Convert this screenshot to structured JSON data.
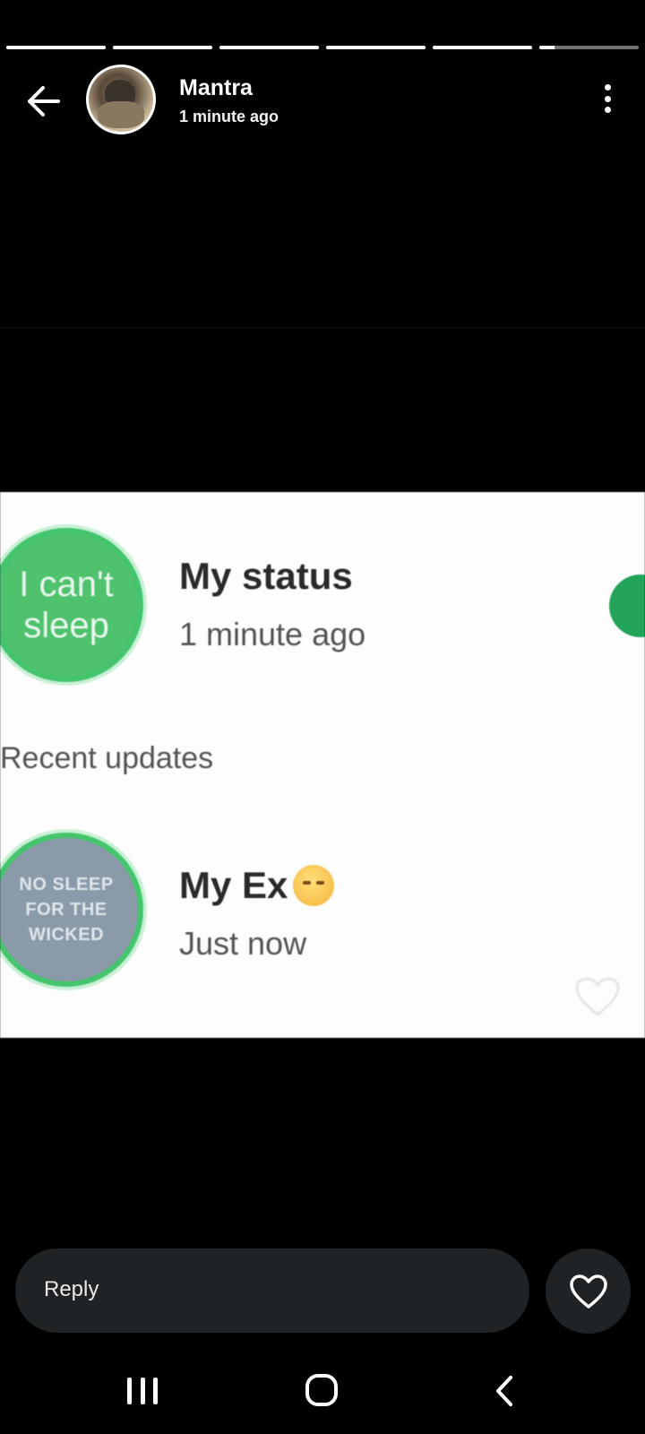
{
  "story": {
    "segments_total": 6,
    "segments_progress": [
      1,
      1,
      1,
      1,
      1,
      0.15
    ]
  },
  "header": {
    "name": "Mantra",
    "time": "1 minute ago",
    "back_icon": "arrow-left-icon",
    "menu_icon": "more-vert-icon"
  },
  "image": {
    "my_status_ring_text": "I can't sleep",
    "my_status_title": "My status",
    "my_status_time": "1 minute ago",
    "recent_updates_label": "Recent updates",
    "ex_ring_text": "NO SLEEP FOR THE WICKED",
    "ex_title": "My Ex",
    "ex_emoji": "😣",
    "ex_time": "Just now",
    "green_accent": "#45c46e"
  },
  "reply": {
    "placeholder": "Reply",
    "heart_icon": "heart-icon"
  },
  "navbar": {
    "recents_icon": "recents-icon",
    "home_icon": "home-icon",
    "back_icon": "nav-back-icon"
  }
}
